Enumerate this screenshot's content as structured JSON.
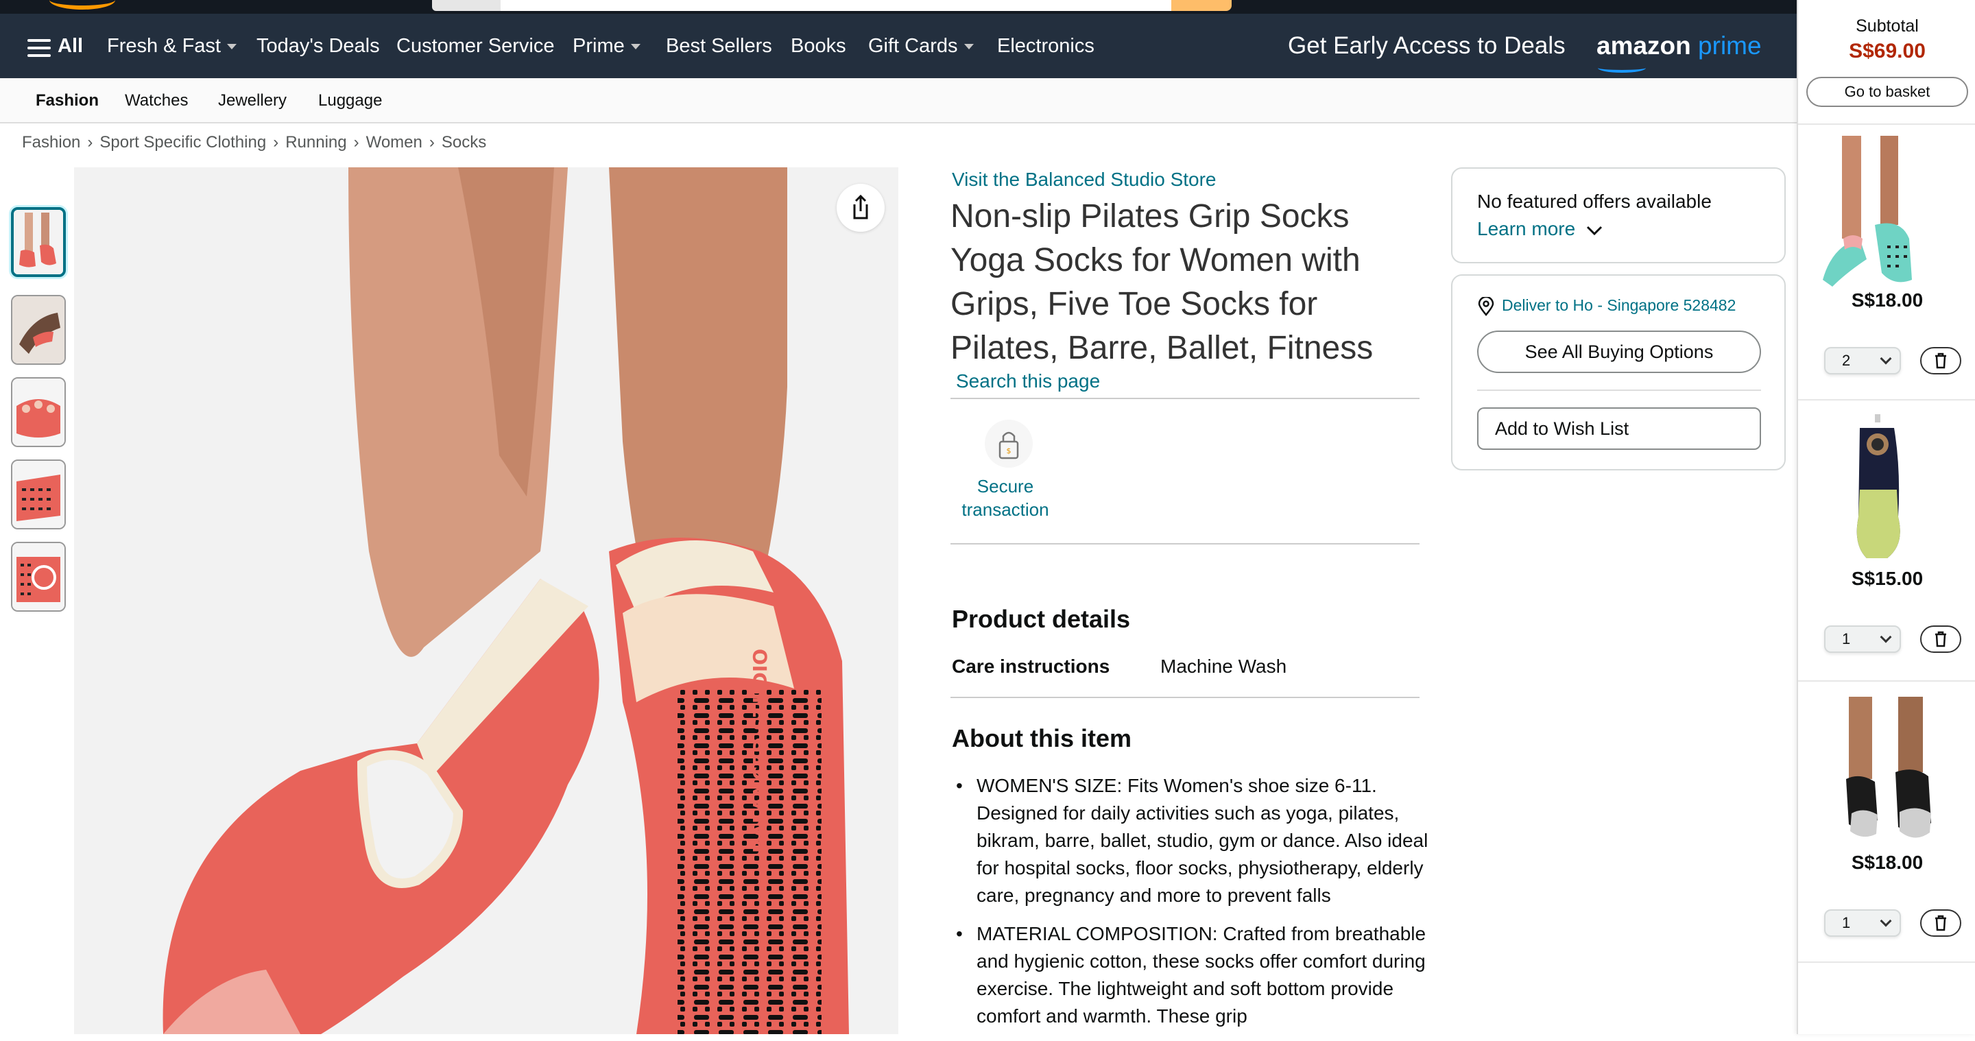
{
  "header": {
    "all_label": "All",
    "nav_items": [
      {
        "label": "Fresh & Fast",
        "dropdown": true
      },
      {
        "label": "Today's Deals",
        "dropdown": false
      },
      {
        "label": "Customer Service",
        "dropdown": false
      },
      {
        "label": "Prime",
        "dropdown": true
      },
      {
        "label": "Best Sellers",
        "dropdown": false
      },
      {
        "label": "Books",
        "dropdown": false
      },
      {
        "label": "Gift Cards",
        "dropdown": true
      },
      {
        "label": "Electronics",
        "dropdown": false
      }
    ],
    "promo": "Get Early Access to Deals",
    "prime_logo_a": "amazon",
    "prime_logo_b": "prime"
  },
  "subnav": {
    "items": [
      "Fashion",
      "Watches",
      "Jewellery",
      "Luggage"
    ]
  },
  "breadcrumb": [
    "Fashion",
    "Sport Specific Clothing",
    "Running",
    "Women",
    "Socks"
  ],
  "product": {
    "store_link": "Visit the Balanced Studio Store",
    "title": "Non-slip Pilates Grip Socks Yoga Socks for Women with Grips, Five Toe Socks for Pilates, Barre, Ballet, Fitness",
    "search_page": "Search this page",
    "secure_label": "Secure transaction",
    "details_heading": "Product details",
    "details": [
      {
        "key": "Care instructions",
        "value": "Machine Wash"
      }
    ],
    "about_heading": "About this item",
    "bullets": [
      "WOMEN'S SIZE: Fits Women's shoe size 6-11. Designed for daily activities such as yoga, pilates, bikram, barre, ballet, studio, gym or dance. Also ideal for hospital socks, floor socks, physiotherapy, elderly care, pregnancy and more to prevent falls",
      "MATERIAL COMPOSITION: Crafted from breathable and hygienic cotton, these socks offer comfort during exercise. The lightweight and soft bottom provide comfort and warmth. These grip"
    ],
    "sock_print": "BALANCED STUDIO"
  },
  "buybox": {
    "no_offers": "No featured offers available",
    "learn_more": "Learn more",
    "deliver_to": "Deliver to Ho - Singapore 528482",
    "see_all_button": "See All Buying Options",
    "wishlist_button": "Add to Wish List"
  },
  "cart": {
    "subtotal_label": "Subtotal",
    "subtotal_value": "S$69.00",
    "basket_button": "Go to basket",
    "items": [
      {
        "price": "S$18.00",
        "qty": "2"
      },
      {
        "price": "S$15.00",
        "qty": "1"
      },
      {
        "price": "S$18.00",
        "qty": "1"
      }
    ]
  },
  "colors": {
    "header_dark": "#131921",
    "nav_bg": "#232f3e",
    "link": "#007185",
    "price_red": "#b12704",
    "prime_blue": "#1a98ff",
    "sock_coral": "#e8635a"
  }
}
